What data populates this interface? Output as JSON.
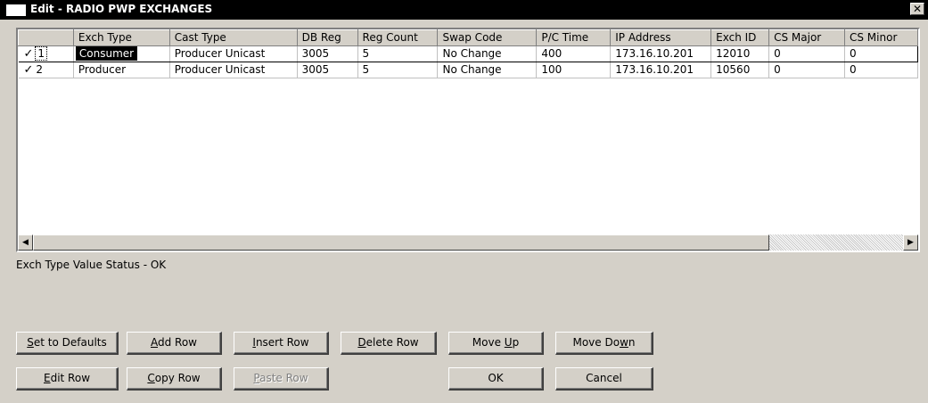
{
  "window": {
    "title": "Edit - RADIO PWP EXCHANGES",
    "close_glyph": "✕"
  },
  "grid": {
    "columns": [
      "",
      "Exch Type",
      "Cast Type",
      "DB Reg",
      "Reg Count",
      "Swap Code",
      "P/C Time",
      "IP Address",
      "Exch ID",
      "CS Major",
      "CS Minor"
    ],
    "rows": [
      {
        "num": "1",
        "check": "✓",
        "exch_type": "Consumer",
        "cast_type": "Producer Unicast",
        "db_reg": "3005",
        "reg_count": "5",
        "swap_code": "No Change",
        "pc_time": "400",
        "ip": "173.16.10.201",
        "exch_id": "12010",
        "cs_major": "0",
        "cs_minor": "0"
      },
      {
        "num": "2",
        "check": "✓",
        "exch_type": "Producer",
        "cast_type": "Producer Unicast",
        "db_reg": "3005",
        "reg_count": "5",
        "swap_code": "No Change",
        "pc_time": "100",
        "ip": "173.16.10.201",
        "exch_id": "10560",
        "cs_major": "0",
        "cs_minor": "0"
      }
    ],
    "scroll_left_glyph": "◀",
    "scroll_right_glyph": "▶"
  },
  "status_text": "Exch Type Value Status - OK",
  "buttons": {
    "set_defaults": {
      "pre": "",
      "u": "S",
      "post": "et to Defaults"
    },
    "add_row": {
      "pre": "",
      "u": "A",
      "post": "dd Row"
    },
    "insert_row": {
      "pre": "",
      "u": "I",
      "post": "nsert Row"
    },
    "delete_row": {
      "pre": "",
      "u": "D",
      "post": "elete Row"
    },
    "move_up": {
      "pre": "Move ",
      "u": "U",
      "post": "p"
    },
    "move_down": {
      "pre": "Move Do",
      "u": "w",
      "post": "n"
    },
    "edit_row": {
      "pre": "",
      "u": "E",
      "post": "dit Row"
    },
    "copy_row": {
      "pre": "",
      "u": "C",
      "post": "opy Row"
    },
    "paste_row": {
      "pre": "",
      "u": "P",
      "post": "aste Row"
    },
    "ok": {
      "label": "OK"
    },
    "cancel": {
      "label": "Cancel"
    }
  },
  "colors": {
    "face": "#d4d0c8",
    "selection": "#000000",
    "disabled_text": "#808080"
  }
}
